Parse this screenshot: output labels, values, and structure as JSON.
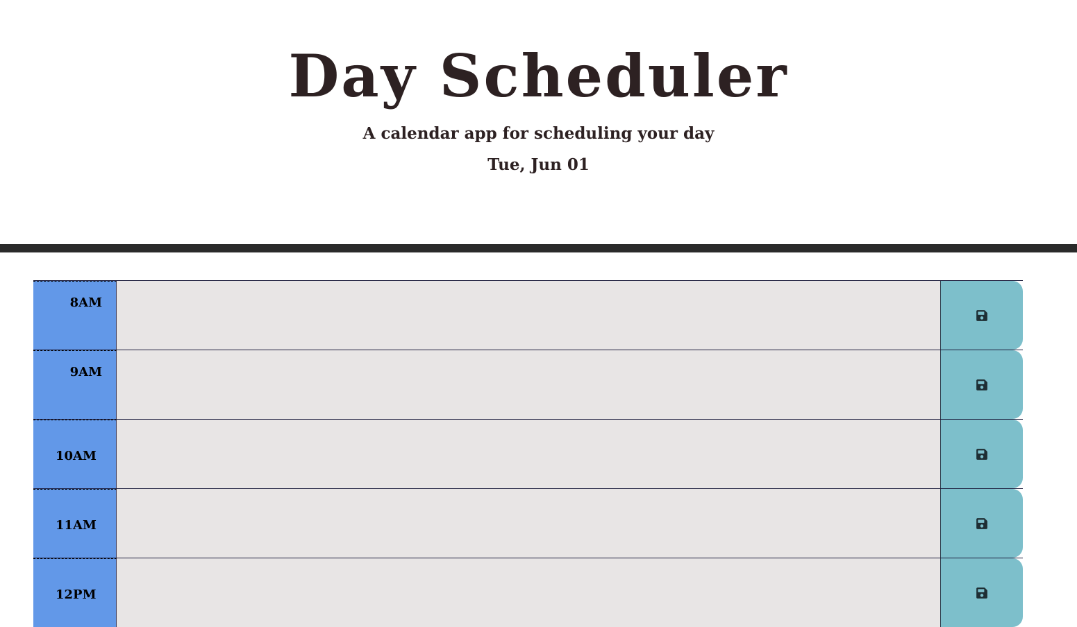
{
  "header": {
    "title": "Day Scheduler",
    "lead": "A calendar app for scheduling your day",
    "current_day": "Tue, Jun 01"
  },
  "colors": {
    "hour_bg": "#6298e8",
    "textarea_bg": "#e8e5e5",
    "save_bg": "#7dbfcb",
    "divider": "#2a2a2a"
  },
  "time_blocks": [
    {
      "hour": "8AM",
      "description": "",
      "save_icon": "floppy-disk-icon"
    },
    {
      "hour": "9AM",
      "description": "",
      "save_icon": "floppy-disk-icon"
    },
    {
      "hour": "10AM",
      "description": "",
      "save_icon": "floppy-disk-icon"
    },
    {
      "hour": "11AM",
      "description": "",
      "save_icon": "floppy-disk-icon"
    },
    {
      "hour": "12PM",
      "description": "",
      "save_icon": "floppy-disk-icon"
    }
  ]
}
